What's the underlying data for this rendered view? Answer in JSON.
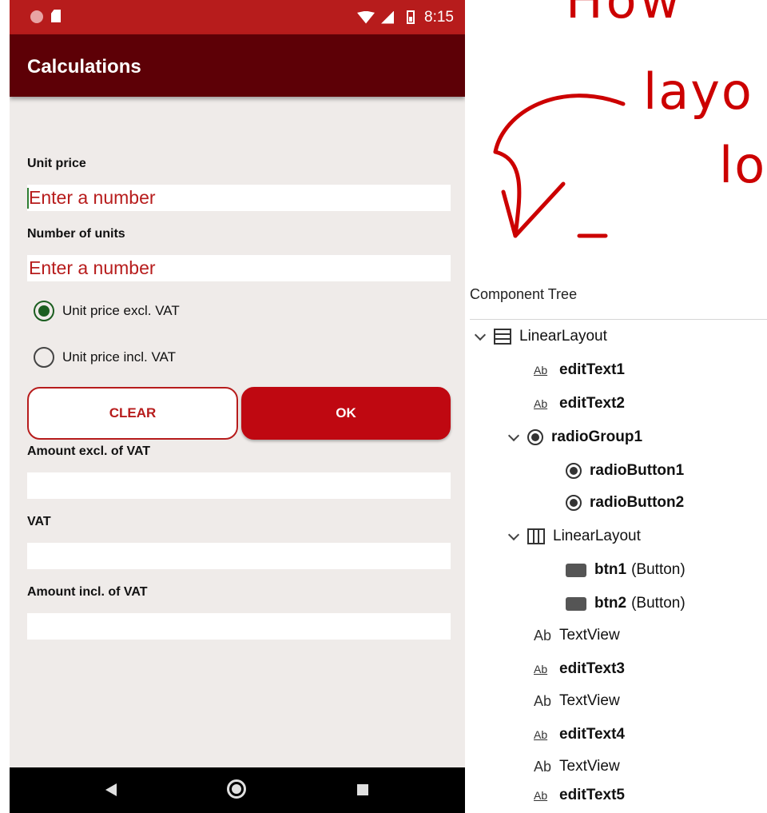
{
  "status_bar": {
    "time": "8:15"
  },
  "app_bar": {
    "title": "Calculations"
  },
  "form": {
    "unit_price_label": "Unit price",
    "unit_price_placeholder": "Enter a number",
    "units_label": "Number of units",
    "units_placeholder": "Enter a number",
    "radio_excl_label": "Unit price excl. VAT",
    "radio_incl_label": "Unit price incl. VAT",
    "radio_selected": "excl",
    "clear_label": "CLEAR",
    "ok_label": "OK",
    "amount_excl_label": "Amount excl. of VAT",
    "vat_label": "VAT",
    "amount_incl_label": "Amount incl. of VAT",
    "amount_excl_value": "",
    "vat_value": "",
    "amount_incl_value": ""
  },
  "annotation": {
    "line1": "How",
    "line2": "layo",
    "line3": "lo",
    "color": "#cc0000"
  },
  "component_tree": {
    "title": "Component Tree",
    "nodes": [
      {
        "name": "LinearLayout",
        "type": "",
        "icon": "linear-layout-vertical-icon",
        "expanded": true
      },
      {
        "name": "editText1",
        "type": "",
        "icon": "edit-text-icon"
      },
      {
        "name": "editText2",
        "type": "",
        "icon": "edit-text-icon"
      },
      {
        "name": "radioGroup1",
        "type": "",
        "icon": "radio-group-icon",
        "expanded": true
      },
      {
        "name": "radioButton1",
        "type": "",
        "icon": "radio-button-icon"
      },
      {
        "name": "radioButton2",
        "type": "",
        "icon": "radio-button-icon"
      },
      {
        "name": "LinearLayout",
        "type": "",
        "icon": "linear-layout-horizontal-icon",
        "expanded": true
      },
      {
        "name": "btn1",
        "type": "(Button)",
        "icon": "button-icon"
      },
      {
        "name": "btn2",
        "type": "(Button)",
        "icon": "button-icon"
      },
      {
        "name": "TextView",
        "type": "",
        "icon": "text-view-icon"
      },
      {
        "name": "editText3",
        "type": "",
        "icon": "edit-text-icon"
      },
      {
        "name": "TextView",
        "type": "",
        "icon": "text-view-icon"
      },
      {
        "name": "editText4",
        "type": "",
        "icon": "edit-text-icon"
      },
      {
        "name": "TextView",
        "type": "",
        "icon": "text-view-icon"
      },
      {
        "name": "editText5",
        "type": "",
        "icon": "edit-text-icon"
      }
    ]
  },
  "colors": {
    "status_bar": "#b71c1c",
    "app_bar": "#5d0006",
    "accent": "#bf0811",
    "radio": "#1b5e20",
    "background": "#efebe9"
  }
}
